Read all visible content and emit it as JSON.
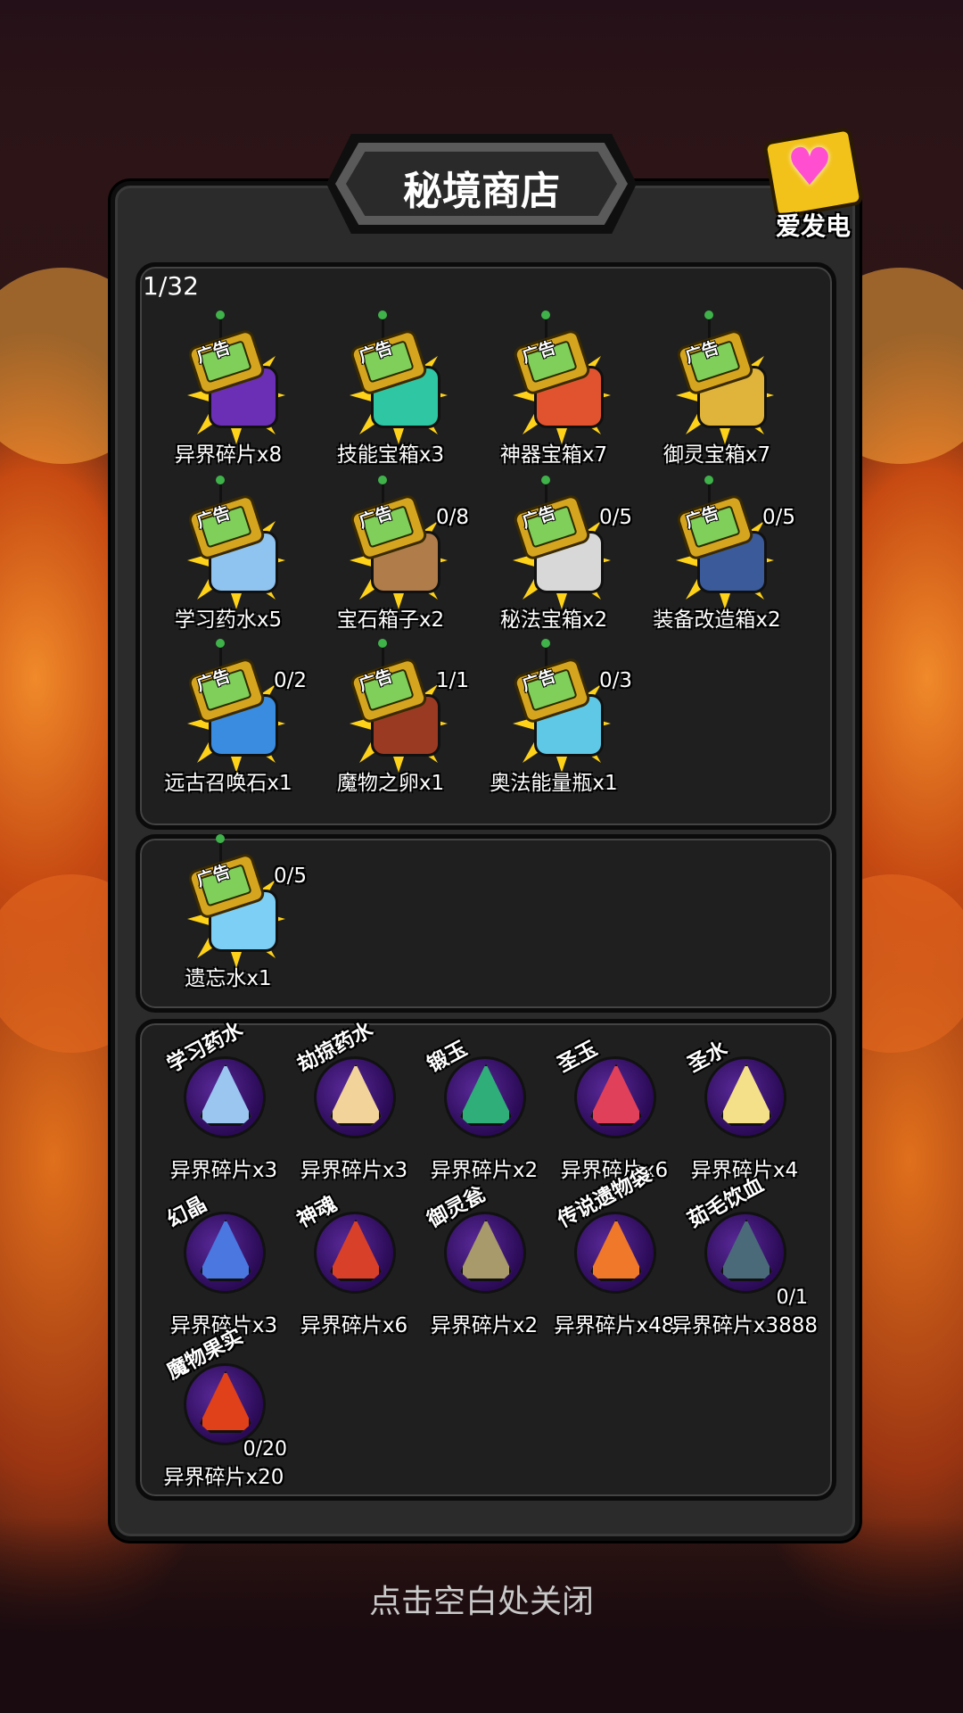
{
  "shop": {
    "title": "秘境商店",
    "support_label": "爱发电",
    "ad_counter": "1/32",
    "close_hint": "点击空白处关闭",
    "ad_tag": "广告"
  },
  "ad_items": [
    {
      "name": "异界碎片x8",
      "count": "",
      "color": "#6b2fb5",
      "icon": "purple-swirl-icon"
    },
    {
      "name": "技能宝箱x3",
      "count": "",
      "color": "#2fc7a3",
      "icon": "chest-icon"
    },
    {
      "name": "神器宝箱x7",
      "count": "",
      "color": "#e1532f",
      "icon": "chest-icon"
    },
    {
      "name": "御灵宝箱x7",
      "count": "",
      "color": "#e0b43a",
      "icon": "chest-icon"
    },
    {
      "name": "学习药水x5",
      "count": "",
      "color": "#8fc3f0",
      "icon": "potion-icon"
    },
    {
      "name": "宝石箱子x2",
      "count": "0/8",
      "color": "#b07d4a",
      "icon": "gem-bag-icon"
    },
    {
      "name": "秘法宝箱x2",
      "count": "0/5",
      "color": "#d8d8d8",
      "icon": "spellbook-icon"
    },
    {
      "name": "装备改造箱x2",
      "count": "0/5",
      "color": "#3a5a9a",
      "icon": "equipment-box-icon"
    },
    {
      "name": "远古召唤石x1",
      "count": "0/2",
      "color": "#3a8ce0",
      "icon": "summon-stone-icon"
    },
    {
      "name": "魔物之卵x1",
      "count": "1/1",
      "color": "#9b3a22",
      "icon": "monster-egg-icon"
    },
    {
      "name": "奥法能量瓶x1",
      "count": "0/3",
      "color": "#5ec8e6",
      "icon": "energy-flask-icon"
    }
  ],
  "special_items": [
    {
      "name": "遗忘水x1",
      "count": "0/5",
      "color": "#7ecff5",
      "icon": "oblivion-water-icon"
    }
  ],
  "shop_items": [
    {
      "label": "学习药水",
      "price": "异界碎片x3",
      "limit": "",
      "color": "#9ac6f0",
      "icon": "potion-icon"
    },
    {
      "label": "劫掠药水",
      "price": "异界碎片x3",
      "limit": "",
      "color": "#f2d49a",
      "icon": "potion-icon"
    },
    {
      "label": "锻玉",
      "price": "异界碎片x2",
      "limit": "",
      "color": "#2fae7a",
      "icon": "jade-icon"
    },
    {
      "label": "圣玉",
      "price": "异界碎片x6",
      "limit": "",
      "color": "#e0405a",
      "icon": "crystal-icon"
    },
    {
      "label": "圣水",
      "price": "异界碎片x4",
      "limit": "",
      "color": "#f5e08a",
      "icon": "holy-water-icon"
    },
    {
      "label": "幻晶",
      "price": "异界碎片x3",
      "limit": "",
      "color": "#4a78e0",
      "icon": "crystal-icon"
    },
    {
      "label": "神魂",
      "price": "异界碎片x6",
      "limit": "",
      "color": "#d8402a",
      "icon": "soul-icon"
    },
    {
      "label": "御灵瓮",
      "price": "异界碎片x2",
      "limit": "",
      "color": "#a89a6a",
      "icon": "urn-icon"
    },
    {
      "label": "传说遗物袋",
      "price": "异界碎片x48",
      "limit": "",
      "color": "#f0782a",
      "icon": "bag-icon"
    },
    {
      "label": "茹毛饮血",
      "price": "异界碎片x3888",
      "limit": "0/1",
      "color": "#4a6a7a",
      "icon": "warrior-icon"
    },
    {
      "label": "魔物果实",
      "price": "异界碎片x20",
      "limit": "0/20",
      "color": "#e0401a",
      "icon": "fruit-icon"
    }
  ]
}
